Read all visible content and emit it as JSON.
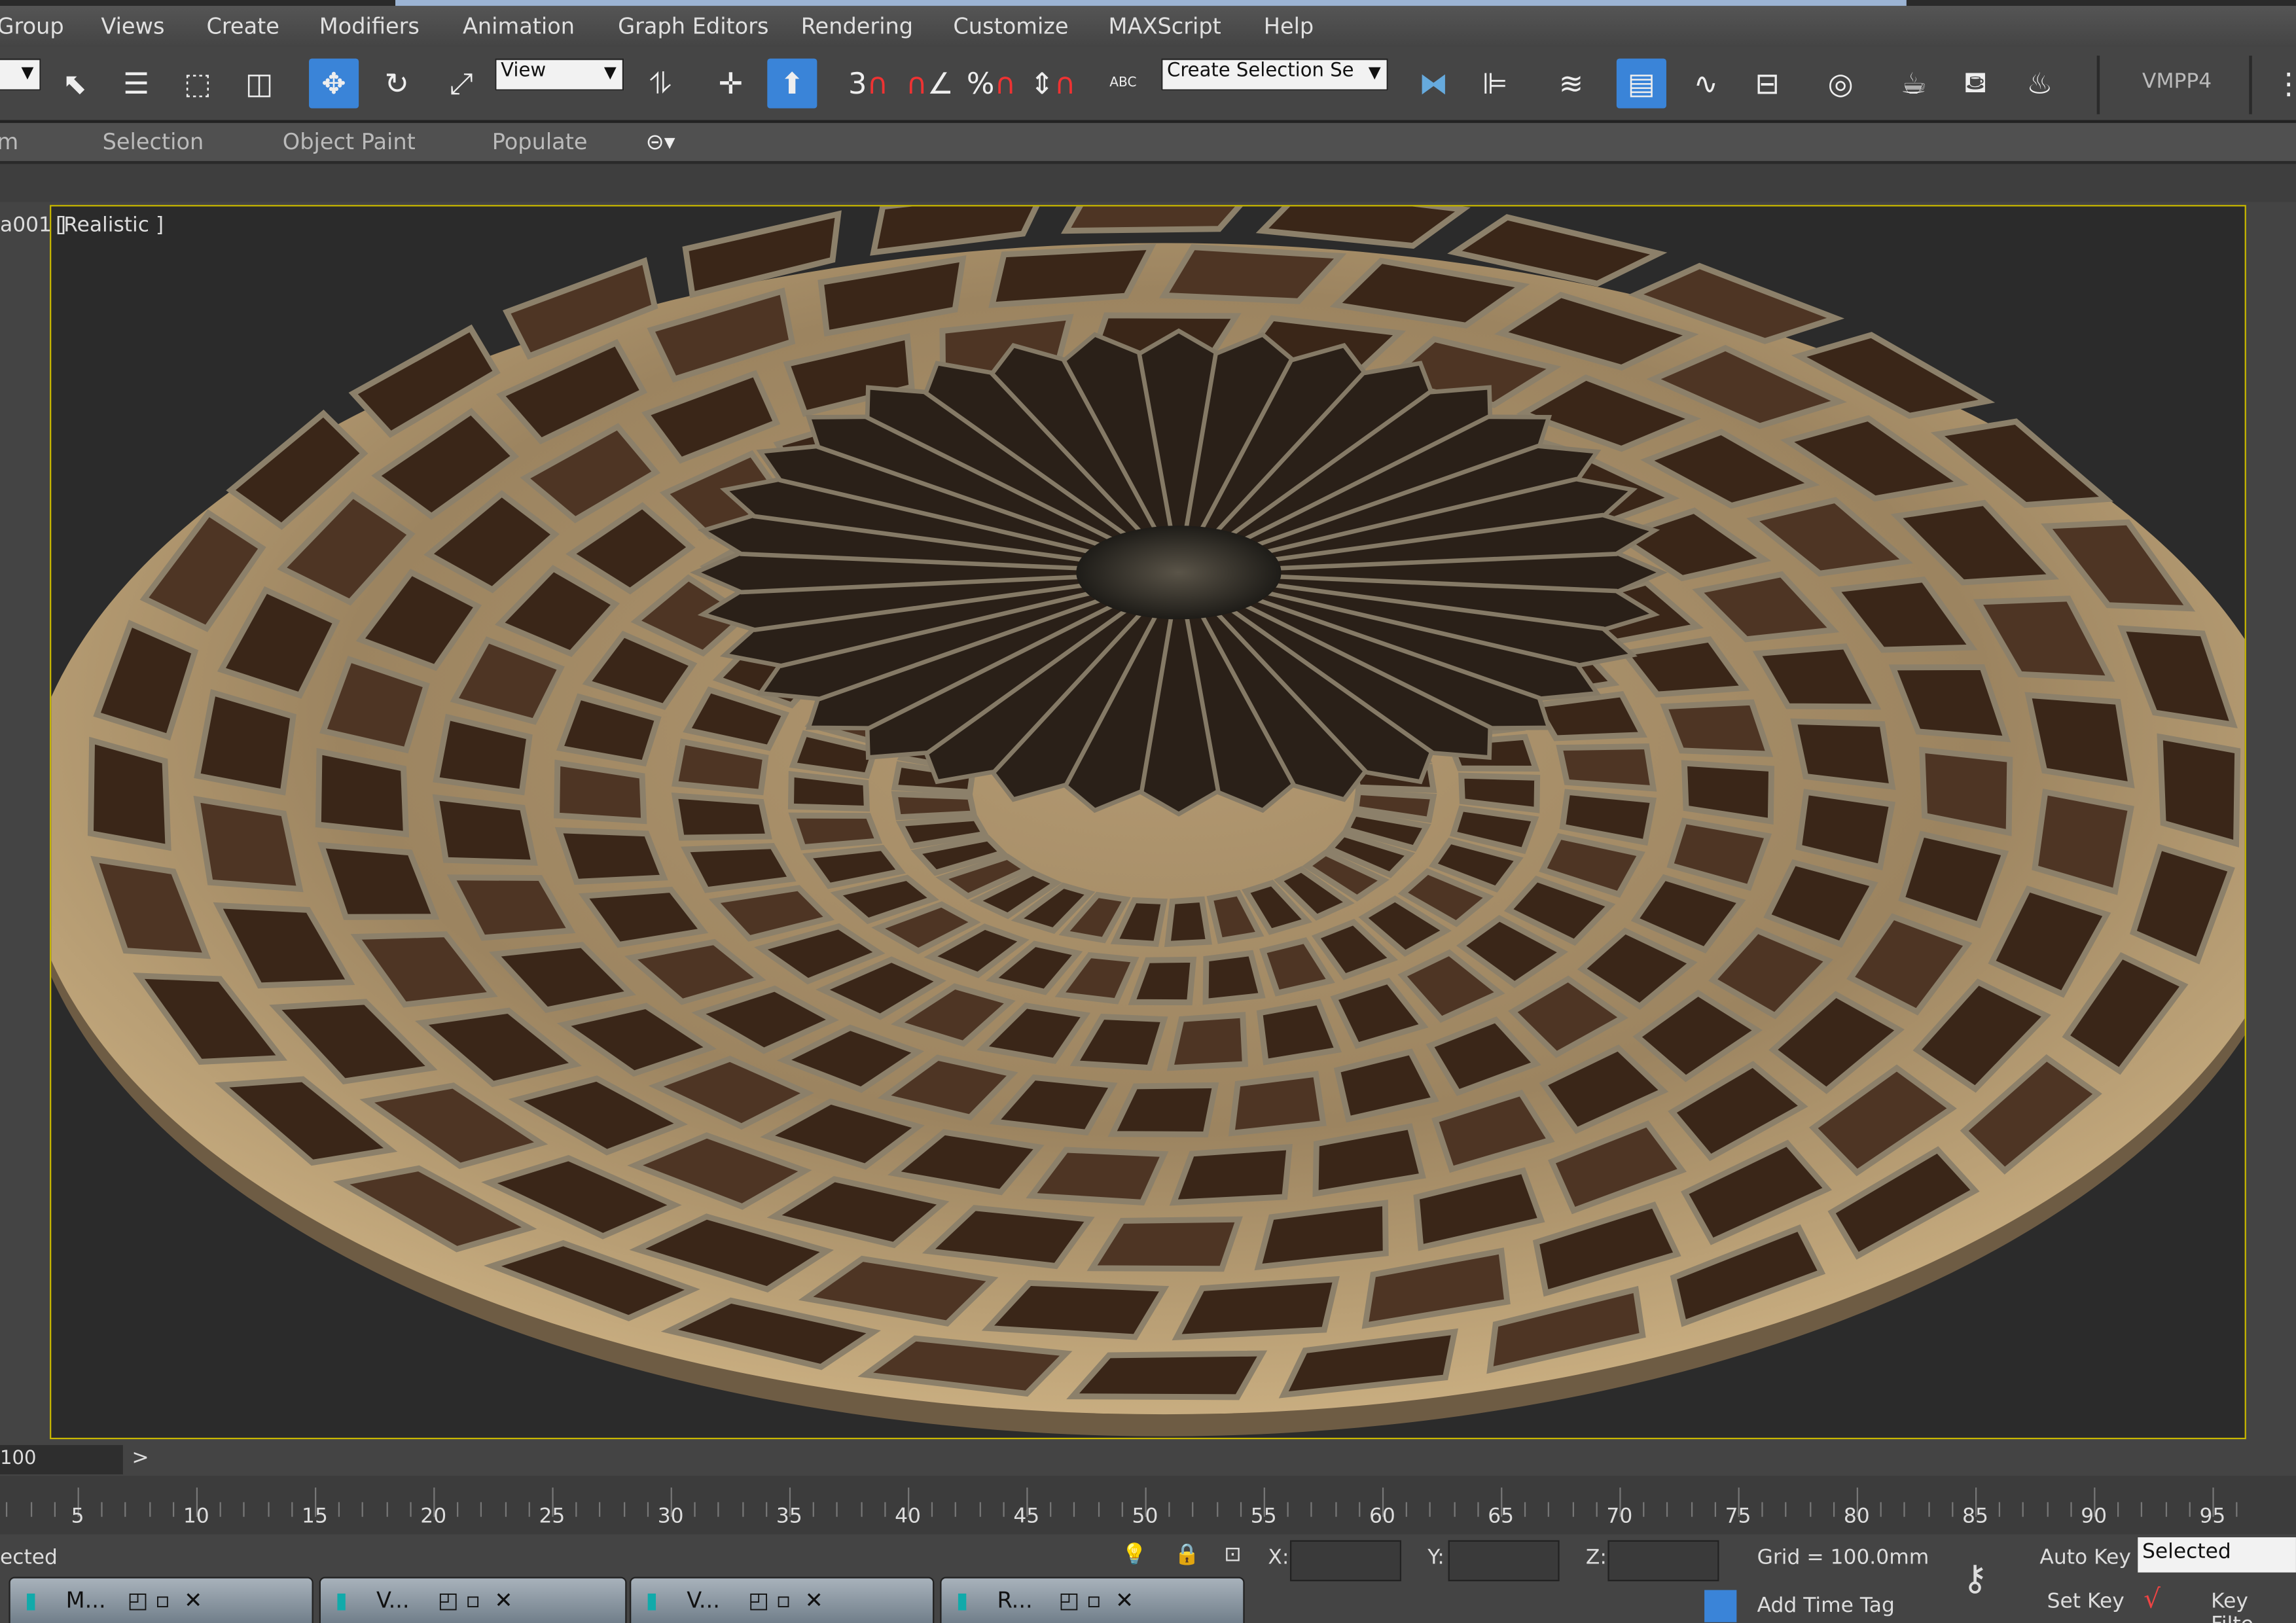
{
  "menu": [
    "Group",
    "Views",
    "Create",
    "Modifiers",
    "Animation",
    "Graph Editors",
    "Rendering",
    "Customize",
    "MAXScript",
    "Help"
  ],
  "toolbar": {
    "view_dropdown": "View",
    "selection_set": "Create Selection Se",
    "snap_3": "3",
    "right_label": "VMPP4",
    "percent": "%",
    "abc": "ABC"
  },
  "ribbon": [
    "m",
    "Selection",
    "Object Paint",
    "Populate"
  ],
  "viewport": {
    "left_label": "a001 ]",
    "label": "[Realistic ]"
  },
  "timeline": {
    "frame": "100",
    "next": ">",
    "ticks": [
      "5",
      "10",
      "15",
      "20",
      "25",
      "30",
      "35",
      "40",
      "45",
      "50",
      "55",
      "60",
      "65",
      "70",
      "75",
      "80",
      "85",
      "90",
      "95"
    ]
  },
  "status": {
    "selected_text": "ected",
    "x_label": "X:",
    "y_label": "Y:",
    "z_label": "Z:",
    "grid": "Grid = 100.0mm",
    "add_time_tag": "Add Time Tag",
    "auto_key": "Auto Key",
    "set_key": "Set Key",
    "key_mode": "Selected",
    "key_filters": "Key Filte"
  },
  "taskbar": [
    {
      "label": "M..."
    },
    {
      "label": "V..."
    },
    {
      "label": "V..."
    },
    {
      "label": "R..."
    }
  ],
  "colors": {
    "viewport_border": "#c8b800",
    "active_blue": "#3a84d8"
  }
}
